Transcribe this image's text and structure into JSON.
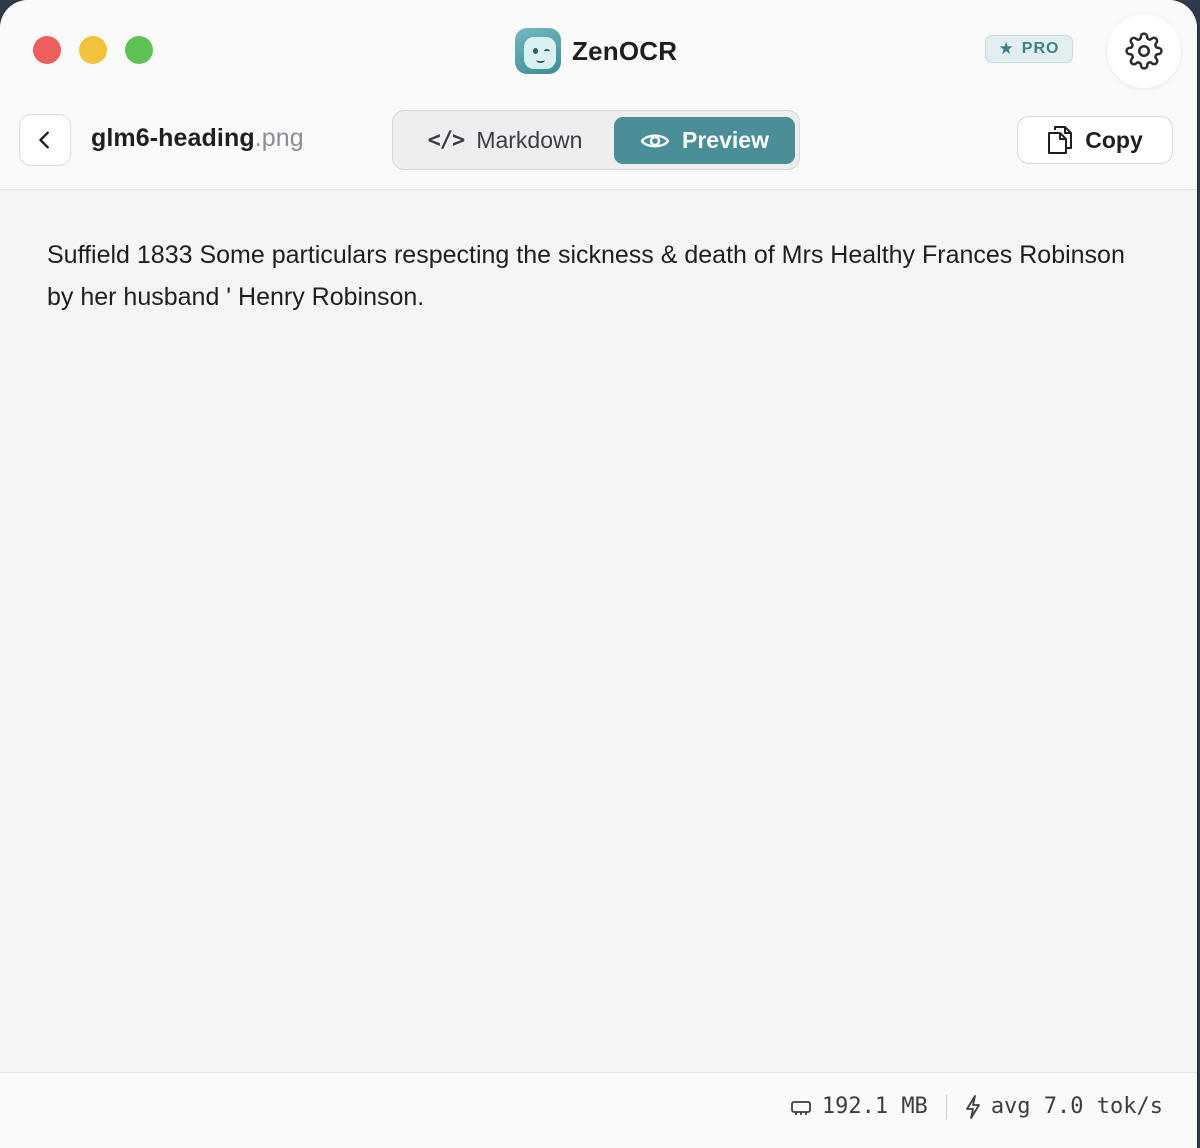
{
  "app": {
    "name": "ZenOCR",
    "pro_label": "PRO"
  },
  "toolbar": {
    "back_icon": "chevron-left-icon",
    "file_base": "glm6-heading",
    "file_ext": ".png",
    "tabs": [
      {
        "label": "Markdown",
        "icon": "code-icon",
        "active": false
      },
      {
        "label": "Preview",
        "icon": "eye-icon",
        "active": true
      }
    ],
    "code_glyph": "</>",
    "copy_label": "Copy"
  },
  "content": {
    "preview_text": "Suffield 1833 Some particulars respecting the sickness & death of Mrs Healthy Frances Robinson by her husband ' Henry Robinson."
  },
  "status": {
    "memory": "192.1 MB",
    "speed": "avg 7.0 tok/s"
  },
  "colors": {
    "accent": "#4a8e98",
    "traffic_close": "#ec5f5a",
    "traffic_min": "#f3c23c",
    "traffic_max": "#5ec153",
    "background": "#f3f5f7"
  }
}
